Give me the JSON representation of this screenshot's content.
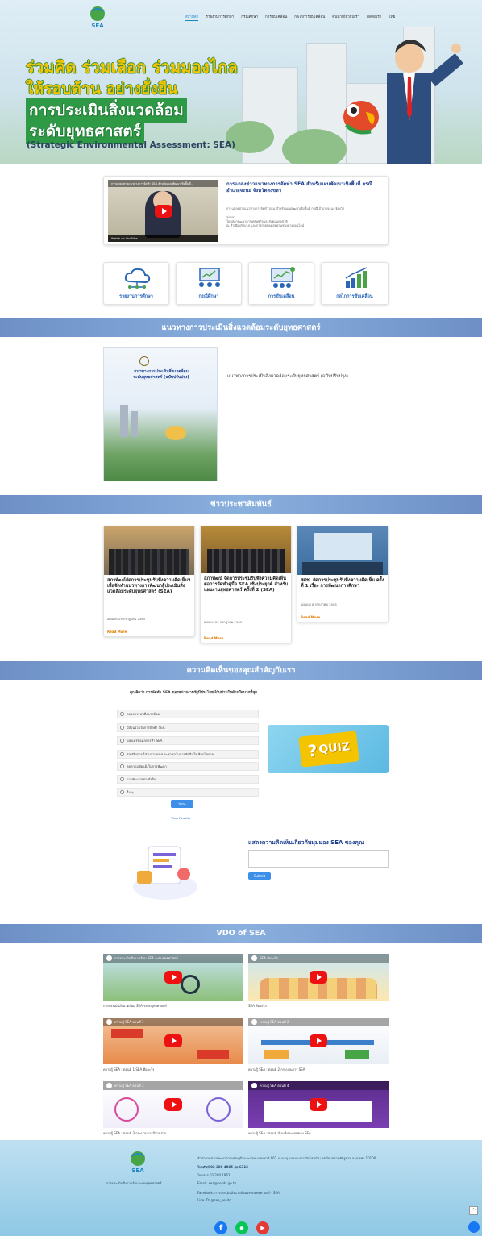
{
  "brand": {
    "logo_text": "SEA"
  },
  "nav": {
    "items": [
      "หน้าหลัก",
      "รายงานการศึกษา",
      "กรณีศึกษา",
      "การขับเคลื่อน",
      "กลไกการขับเคลื่อน",
      "ค้นหาเกี่ยวกับเรา",
      "ติดต่อเรา"
    ],
    "lang": "ไทย"
  },
  "hero": {
    "line1": "ร่วมคิด ร่วมเลือก ร่วมมองไกล",
    "line2": "ให้รอบด้าน อย่างยั่งยืน",
    "line3": "การประเมินสิ่งแวดล้อม",
    "line4": "ระดับยุทธศาสตร์",
    "english": "(Strategic Environmental Assessment: SEA)"
  },
  "featured": {
    "video_title": "การแถลงข่าวแนวทางการจัดทำ SEA สำหรับแผนพัฒนาเชิงพื้นที่...",
    "yt_label": "Watch on YouTube",
    "title": "การแถลงข่าวแนวทางการจัดทำ SEA สำหรับแผนพัฒนาเชิงพื้นที่ กรณี อำเภอจะนะ จังหวัดสงขลา",
    "body1": "การแถลงข่าวแนวทางการจัดทำ SEA สำหรับแผนพัฒนาเชิงพื้นที่ กรณี อำเภอจะนะ จังหวัด",
    "body2": "สงขลา",
    "body3": "โดยสภาพัฒนาการเศรษฐกิจและสังคมแห่งชาติ",
    "body4": "ณ ทำเนียบรัฐบาล และการถ่ายทอดสดผ่านช่องทางออนไลน์"
  },
  "categories": [
    {
      "label": "รายงานการศึกษา",
      "icon": "cloud-network-icon"
    },
    {
      "label": "กรณีศึกษา",
      "icon": "presentation-icon"
    },
    {
      "label": "การขับเคลื่อน",
      "icon": "monitor-team-icon"
    },
    {
      "label": "กลไกการขับเคลื่อน",
      "icon": "growth-chart-icon"
    }
  ],
  "guideline": {
    "heading": "แนวทางการประเมินสิ่งแวดล้อมระดับยุทธศาสตร์",
    "book_title": "แนวทางการประเมินสิ่งแวดล้อมระดับยุทธศาสตร์ (ฉบับปรับปรุง)",
    "cover_line1": "แนวทางการประเมินสิ่งแวดล้อม",
    "cover_line2": "ระดับยุทธศาสตร์ (ฉบับปรับปรุง)"
  },
  "news": {
    "heading": "ข่าวประชาสัมพันธ์",
    "items": [
      {
        "title": "สภาพัฒน์จัดการประชุมรับฟังความคิดเห็นฯ เพื่อจัดทำแนวทางการพัฒนาผู้ประเมินสิ่งแวดล้อมระดับยุทธศาสตร์ (SEA)",
        "date": "เผยแพร่ 29 กรกฎาคม 2565",
        "more": "Read More"
      },
      {
        "title": "สภาพัฒน์ จัดการประชุมรับฟังความคิดเห็นต่อการจัดทำคู่มือ SEA เชิงประยุกต์ สำหรับแผนงานยุทธศาสตร์ ครั้งที่ 2 (SEA)",
        "date": "เผยแพร่ 22 กรกฎาคม 2565",
        "more": "Read More"
      },
      {
        "title": "สศช. จัดการประชุมรับฟังความคิดเห็น ครั้งที่ 1 เรื่อง การพัฒนาการศึกษา",
        "date": "เผยแพร่ 8 กรกฎาคม 2565",
        "more": "Read More"
      }
    ]
  },
  "opinion": {
    "heading": "ความคิดเห็นของคุณสำคัญกับเรา",
    "question": "คุณคิดว่า การจัดทำ SEA ของหน่วยงานรัฐมีประโยชน์กับท่านในด้านใดมากที่สุด",
    "options": [
      "ลดผลกระทบสิ่งแวดล้อม",
      "มีส่วนร่วมในการจัดทำ SEA",
      "เผยแพร่ข้อมูลการทำ SEA",
      "ส่งเสริมการมีส่วนร่วมของประชาชนในการตัดสินใจเชิงนโยบาย",
      "ลดความขัดแย้งในการพัฒนา",
      "การพัฒนาอย่างยั่งยืน",
      "อื่น ๆ"
    ],
    "vote": "Vote",
    "results": "View Results",
    "quiz": "QUIZ",
    "comment_title": "แสดงความคิดเห็นเกี่ยวกับมุมมอง SEA ของคุณ",
    "submit": "Submit"
  },
  "videos": {
    "heading": "VDO of SEA",
    "items": [
      {
        "thumb": "การประเมินสิ่งแวดล้อม SEA ระดับยุทธศาสตร์",
        "caption": "การประเมินสิ่งแวดล้อม SEA ระดับยุทธศาสตร์"
      },
      {
        "thumb": "SEA คืออะไร",
        "caption": "SEA คืออะไร"
      },
      {
        "thumb": "ความรู้ SEA ตอนที่ 1",
        "caption": "ความรู้ SEA : ตอนที่ 1 SEA คืออะไร"
      },
      {
        "thumb": "ความรู้ SEA ตอนที่ 2",
        "caption": "ความรู้ SEA : ตอนที่ 2 กระบวนการ SEA"
      },
      {
        "thumb": "ความรู้ SEA ตอนที่ 3",
        "caption": "ความรู้ SEA : ตอนที่ 3 กระบวนการมีส่วนร่วม"
      },
      {
        "thumb": "ความรู้ SEA ตอนที่ 4",
        "caption": "ความรู้ SEA : ตอนที่ 4 องค์ประกอบของ SEA"
      }
    ]
  },
  "footer": {
    "org": "การประเมินสิ่งแวดล้อมระดับยุทธศาสตร์",
    "address": "สำนักงานสภาพัฒนาการเศรษฐกิจและสังคมแห่งชาติ 962 ถนนกรุงเกษม แขวงวัดโสมนัส เขตป้อมปราบศัตรูพ่าย กรุงเทพฯ 10100",
    "phone": "โทรศัพท์ 02 280 4085 ต่อ 6312",
    "fax": "โทรสาร 02 280 1862",
    "email": "Email: sea@nesdc.go.th",
    "facebook": "Facebook: การประเมินสิ่งแวดล้อมระดับยุทธศาสตร์ - SEA",
    "line": "Line ID: @sea_nesdc"
  },
  "colors": {
    "band": "#7b9fd4",
    "accent": "#1f86c7",
    "yellow": "#f5c400"
  }
}
